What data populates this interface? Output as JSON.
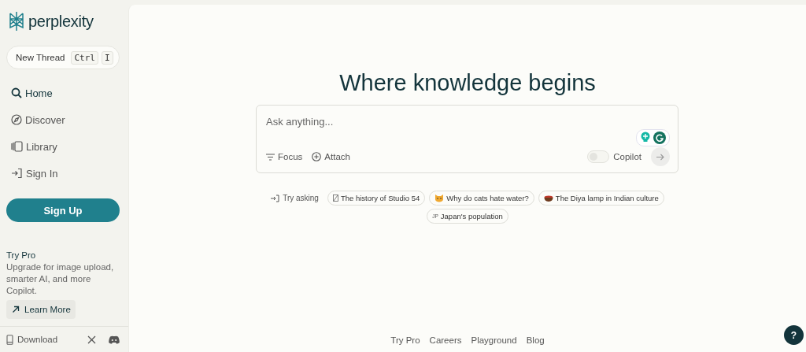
{
  "sidebar": {
    "logo": "perplexity",
    "new_thread": {
      "label": "New Thread",
      "keys": [
        "Ctrl",
        "I"
      ]
    },
    "nav": [
      {
        "label": "Home",
        "selected": true
      },
      {
        "label": "Discover",
        "selected": false
      },
      {
        "label": "Library",
        "selected": false
      },
      {
        "label": "Sign In",
        "selected": false
      }
    ],
    "sign_up": "Sign Up",
    "promo": {
      "title": "Try Pro",
      "text": "Upgrade for image upload, smarter AI, and more Copilot.",
      "button": "Learn More"
    },
    "download": "Download"
  },
  "main": {
    "heading": "Where knowledge begins",
    "search": {
      "placeholder": "Ask anything...",
      "focus": "Focus",
      "attach": "Attach",
      "copilot": {
        "label": "Copilot",
        "on": false
      }
    },
    "try_asking": "Try asking",
    "suggestions": [
      {
        "label": "The history of Studio 54"
      },
      {
        "label": "Why do cats hate water?"
      },
      {
        "label": "The Diya lamp in Indian culture"
      },
      {
        "prefix": "JP",
        "label": "Japan's population"
      }
    ],
    "footer": [
      "Try Pro",
      "Careers",
      "Playground",
      "Blog"
    ],
    "help": "?"
  }
}
